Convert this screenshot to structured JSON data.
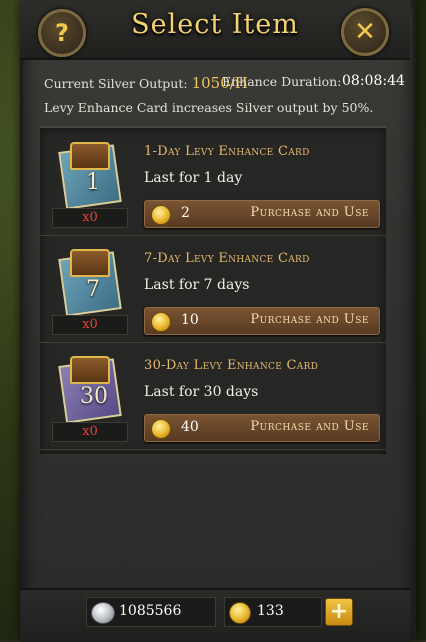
{
  "header": {
    "title": "Select Item",
    "help_glyph": "?",
    "close_glyph": "✕"
  },
  "info": {
    "silver_label": "Current Silver Output:",
    "silver_value": "1050/H",
    "duration_label": "Enhance Duration:",
    "duration_value": "08:08:44",
    "description": "Levy Enhance Card increases Silver output by 50%."
  },
  "items": [
    {
      "name": "1-Day Levy Enhance Card",
      "desc": "Last for 1 day",
      "quantity": "x0",
      "price": "2",
      "button": "Purchase and Use",
      "card_number": "1"
    },
    {
      "name": "7-Day Levy Enhance Card",
      "desc": "Last for 7 days",
      "quantity": "x0",
      "price": "10",
      "button": "Purchase and Use",
      "card_number": "7"
    },
    {
      "name": "30-Day Levy Enhance Card",
      "desc": "Last for 30 days",
      "quantity": "x0",
      "price": "40",
      "button": "Purchase and Use",
      "card_number": "30"
    }
  ],
  "footer": {
    "silver": "1085566",
    "gold": "133",
    "plus_glyph": "+"
  },
  "icons": {
    "silver": "silver-coin-icon",
    "gold": "gold-coin-icon",
    "card": "levy-enhance-card-icon"
  },
  "colors": {
    "title": "#f4d274",
    "highlight": "#f1c55a",
    "quantity": "#e0443a",
    "button": "#7a5432"
  }
}
